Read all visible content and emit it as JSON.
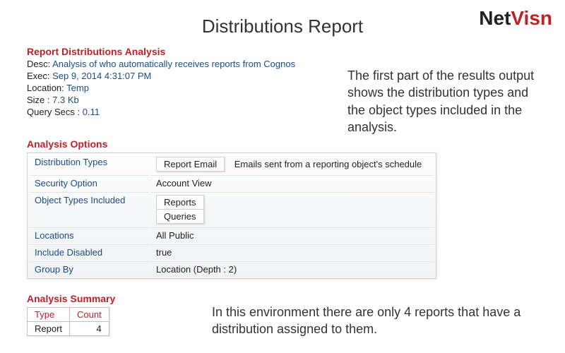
{
  "page_title": "Distributions Report",
  "logo": {
    "part1": "Net",
    "part2": "Visn"
  },
  "meta": {
    "heading": "Report Distributions Analysis",
    "desc_label": "Desc:",
    "desc_value": "Analysis of who automatically receives reports from Cognos",
    "exec_label": "Exec:",
    "exec_value": "Sep 9, 2014 4:31:07 PM",
    "location_label": "Location:",
    "location_value": "Temp",
    "size_label": "Size :",
    "size_value": "7.3 Kb",
    "query_label": "Query Secs :",
    "query_value": "0.11"
  },
  "commentary1": "The first part of the results output shows the distribution types and the object types included in the analysis.",
  "commentary2": "In this environment there are only 4 reports that have a distribution assigned to them.",
  "options": {
    "heading": "Analysis Options",
    "dist_types_label": "Distribution Types",
    "dist_types_pill": "Report Email",
    "dist_types_desc": "Emails sent from a reporting object's schedule",
    "security_label": "Security Option",
    "security_value": "Account View",
    "obj_types_label": "Object Types Included",
    "obj_types_pill1": "Reports",
    "obj_types_pill2": "Queries",
    "locations_label": "Locations",
    "locations_value": "All Public",
    "include_disabled_label": "Include Disabled",
    "include_disabled_value": "true",
    "group_by_label": "Group By",
    "group_by_value": "Location (Depth : 2)"
  },
  "summary": {
    "heading": "Analysis Summary",
    "type_header": "Type",
    "count_header": "Count",
    "row_type": "Report",
    "row_count": "4"
  }
}
